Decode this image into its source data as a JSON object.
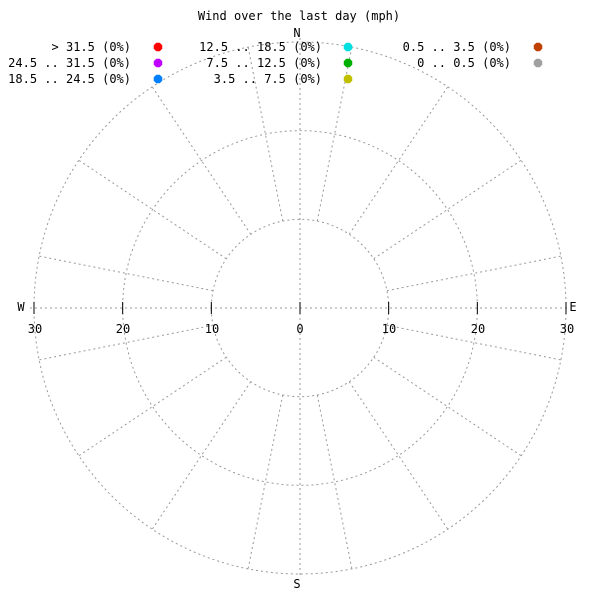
{
  "chart_data": {
    "type": "polar-wind-rose",
    "title": "Wind over the last day (mph)",
    "directions": {
      "north": "N",
      "south": "S",
      "east": "E",
      "west": "W"
    },
    "radial_ticks": {
      "left": [
        "30",
        "20",
        "10"
      ],
      "center": "0",
      "right": [
        "10",
        "20",
        "30"
      ]
    },
    "radial_max": 30,
    "radial_rings": [
      10,
      20,
      30
    ],
    "sector_count": 16,
    "grid": true,
    "legend": {
      "placement": "top",
      "entries": [
        {
          "label": "> 31.5 (0%)",
          "color": "#ff0000"
        },
        {
          "label": "24.5 .. 31.5 (0%)",
          "color": "#c000ff"
        },
        {
          "label": "18.5 .. 24.5 (0%)",
          "color": "#0080ff"
        },
        {
          "label": "12.5 .. 18.5 (0%)",
          "color": "#00e0e0"
        },
        {
          "label": "7.5 .. 12.5 (0%)",
          "color": "#00b000"
        },
        {
          "label": "3.5 .. 7.5 (0%)",
          "color": "#c0c000"
        },
        {
          "label": "0.5 .. 3.5 (0%)",
          "color": "#c04000"
        },
        {
          "label": "0 .. 0.5 (0%)",
          "color": "#a0a0a0"
        }
      ]
    },
    "series": [
      {
        "range": "> 31.5",
        "percent": 0
      },
      {
        "range": "24.5 .. 31.5",
        "percent": 0
      },
      {
        "range": "18.5 .. 24.5",
        "percent": 0
      },
      {
        "range": "12.5 .. 18.5",
        "percent": 0
      },
      {
        "range": "7.5 .. 12.5",
        "percent": 0
      },
      {
        "range": "3.5 .. 7.5",
        "percent": 0
      },
      {
        "range": "0.5 .. 3.5",
        "percent": 0
      },
      {
        "range": "0 .. 0.5",
        "percent": 0
      }
    ]
  }
}
